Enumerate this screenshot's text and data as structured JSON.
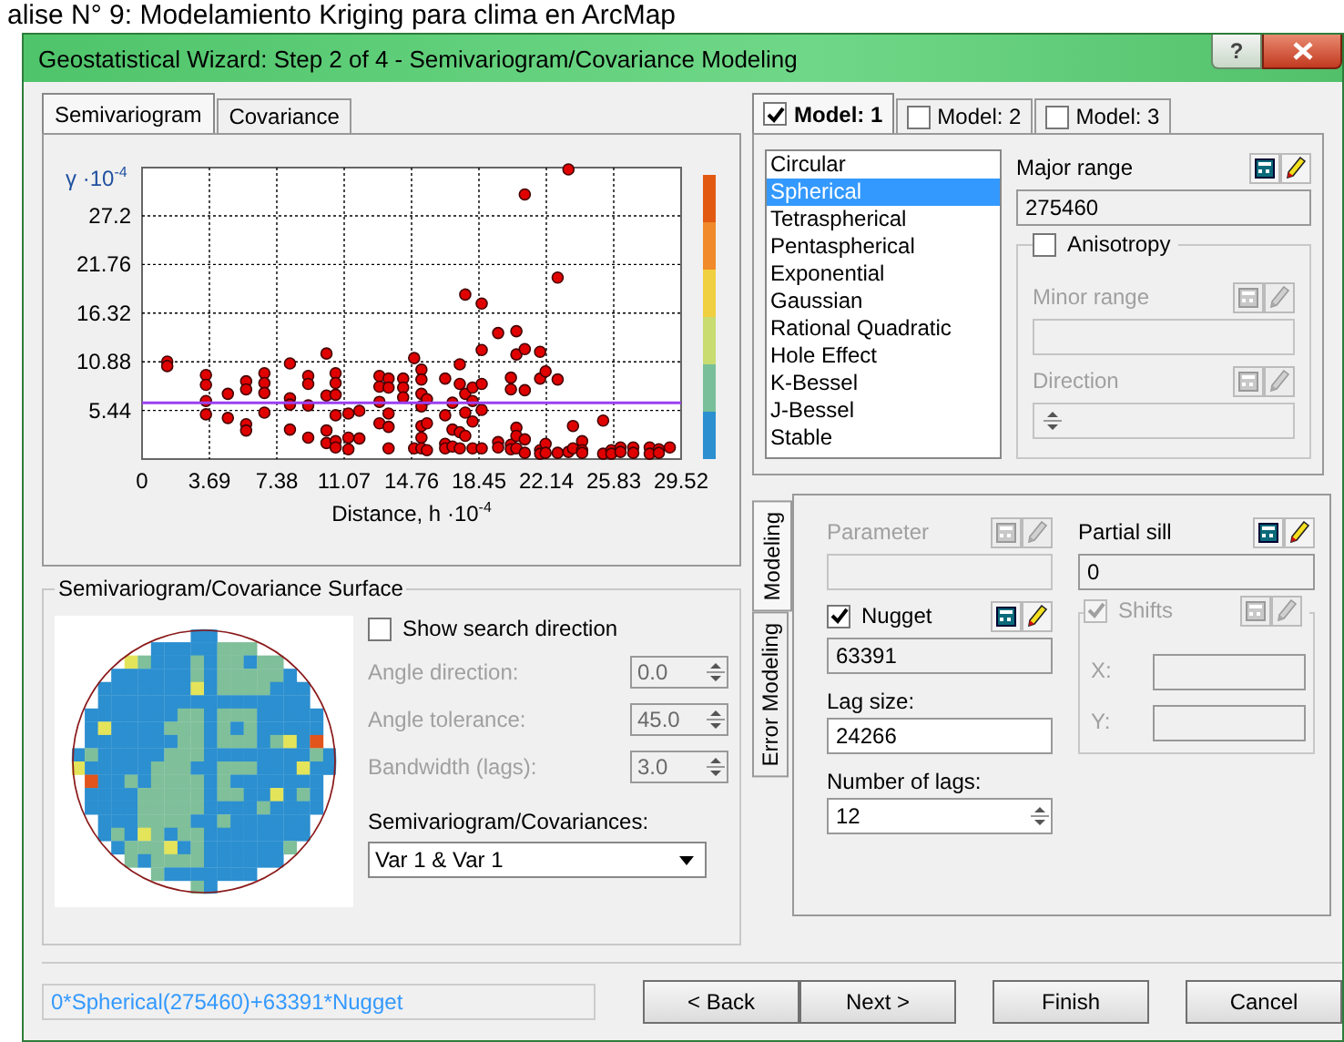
{
  "background_caption": "alise N° 9: Modelamiento Kriging para clima en ArcMap",
  "window": {
    "title": "Geostatistical Wizard: Step 2 of 4 - Semivariogram/Covariance Modeling",
    "help": "?"
  },
  "left_tabs": [
    {
      "label": "Semivariogram",
      "selected": true
    },
    {
      "label": "Covariance",
      "selected": false
    }
  ],
  "chart": {
    "chart_data": {
      "type": "scatter",
      "xlabel": "Distance, h ·10$^{-4}$",
      "ylabel": "γ ·10$^{-4}$",
      "xlim": [
        0,
        29.52
      ],
      "ylim": [
        0,
        32.6
      ],
      "xticks": [
        0,
        3.69,
        7.38,
        11.07,
        14.76,
        18.45,
        22.14,
        25.83,
        29.52
      ],
      "yticks": [
        5.44,
        10.88,
        16.32,
        21.76,
        27.2
      ],
      "x": [
        1.38,
        1.38,
        3.5,
        3.5,
        3.5,
        3.5,
        4.7,
        4.7,
        5.7,
        5.7,
        5.7,
        5.7,
        6.7,
        6.7,
        6.7,
        6.7,
        8.1,
        8.1,
        8.1,
        8.1,
        9.1,
        9.1,
        9.1,
        9.1,
        10.1,
        10.1,
        10.1,
        10.1,
        10.6,
        10.6,
        10.6,
        10.6,
        10.6,
        10.6,
        11.3,
        11.3,
        11.3,
        11.9,
        11.9,
        13.0,
        13.0,
        13.0,
        13.0,
        13.5,
        13.5,
        13.5,
        13.5,
        13.5,
        14.3,
        14.3,
        14.3,
        14.9,
        14.9,
        15.3,
        15.3,
        15.3,
        15.3,
        15.3,
        15.3,
        15.3,
        15.6,
        15.6,
        15.6,
        16.6,
        16.6,
        16.6,
        16.6,
        17.0,
        17.0,
        17.0,
        17.4,
        17.4,
        17.4,
        17.4,
        17.7,
        17.7,
        17.7,
        17.7,
        18.1,
        18.1,
        18.1,
        18.1,
        18.6,
        18.6,
        18.6,
        18.6,
        18.6,
        19.5,
        19.5,
        19.5,
        20.2,
        20.2,
        20.2,
        20.2,
        20.5,
        20.5,
        20.5,
        20.5,
        20.5,
        20.96,
        20.96,
        20.96,
        20.96,
        20.96,
        21.8,
        21.8,
        21.8,
        21.8,
        22.1,
        22.1,
        22.1,
        22.76,
        22.76,
        22.76,
        23.35,
        23.35,
        23.6,
        23.6,
        24.1,
        24.1,
        24.1,
        25.25,
        25.25,
        25.7,
        25.7,
        26.2,
        26.2,
        26.9,
        26.9,
        27.8,
        27.8,
        28.3,
        28.3,
        28.9
      ],
      "grid": true,
      "series": [
        {
          "color": "#e00000",
          "values": [
            10.9,
            10.4,
            9.4,
            8.3,
            6.5,
            5.0,
            7.3,
            4.6,
            8.7,
            7.8,
            3.9,
            3.2,
            9.6,
            8.5,
            7.4,
            5.2,
            10.7,
            6.8,
            6.1,
            3.3,
            9.3,
            8.4,
            6.0,
            2.4,
            11.8,
            7.1,
            3.2,
            1.8,
            9.6,
            8.5,
            7.2,
            4.9,
            2.0,
            1.3,
            5.1,
            2.4,
            1.1,
            5.4,
            2.3,
            9.3,
            8.1,
            6.4,
            4.0,
            9.0,
            8.0,
            5.1,
            3.6,
            1.2,
            9.0,
            8.0,
            6.9,
            11.3,
            1.2,
            10.0,
            8.9,
            7.3,
            5.9,
            3.7,
            2.4,
            1.2,
            6.7,
            4.0,
            1.0,
            9.0,
            4.9,
            1.7,
            1.2,
            6.3,
            3.3,
            1.4,
            10.6,
            8.4,
            3.0,
            1.2,
            18.4,
            7.3,
            5.2,
            2.6,
            8.0,
            6.5,
            4.2,
            1.2,
            17.4,
            12.2,
            8.4,
            5.5,
            1.2,
            14.1,
            1.9,
            1.3,
            9.1,
            7.8,
            1.6,
            1.1,
            14.3,
            11.7,
            3.5,
            2.6,
            1.2,
            29.6,
            12.3,
            7.7,
            2.2,
            0.7,
            12.0,
            9.0,
            1.0,
            0.6,
            9.8,
            1.7,
            0.7,
            20.3,
            8.9,
            0.7,
            32.4,
            0.8,
            3.7,
            1.2,
            2.0,
            1.0,
            0.7,
            4.3,
            0.6,
            1.0,
            0.6,
            1.3,
            0.8,
            1.3,
            0.7,
            1.3,
            0.6,
            1.1,
            0.7,
            1.3
          ]
        }
      ],
      "ref_lines": [
        {
          "axis": "y",
          "value": 6.3
        }
      ]
    }
  },
  "surface": {
    "title": "Semivariogram/Covariance Surface",
    "show_search_direction": {
      "label": "Show search direction",
      "checked": false
    },
    "fields": [
      {
        "label": "Angle direction:",
        "value": "0.0",
        "disabled": true
      },
      {
        "label": "Angle tolerance:",
        "value": "45.0",
        "disabled": true
      },
      {
        "label": "Bandwidth (lags):",
        "value": "3.0",
        "disabled": true
      }
    ],
    "dropdown_label": "Semivariogram/Covariances:",
    "dropdown_value": "Var 1 & Var 1"
  },
  "model_tabs": [
    {
      "label": "Model:  1",
      "checked": true,
      "selected": true
    },
    {
      "label": "Model:  2",
      "checked": false,
      "selected": false
    },
    {
      "label": "Model:  3",
      "checked": false,
      "selected": false
    }
  ],
  "model_types": [
    {
      "label": "Circular",
      "selected": false
    },
    {
      "label": "Spherical",
      "selected": true
    },
    {
      "label": "Tetraspherical",
      "selected": false
    },
    {
      "label": "Pentaspherical",
      "selected": false
    },
    {
      "label": "Exponential",
      "selected": false
    },
    {
      "label": "Gaussian",
      "selected": false
    },
    {
      "label": "Rational Quadratic",
      "selected": false
    },
    {
      "label": "Hole Effect",
      "selected": false
    },
    {
      "label": "K-Bessel",
      "selected": false
    },
    {
      "label": "J-Bessel",
      "selected": false
    },
    {
      "label": "Stable",
      "selected": false
    }
  ],
  "major_range": {
    "label": "Major range",
    "value": "275460",
    "read_only": true
  },
  "anisotropy": {
    "label": "Anisotropy",
    "checked": false
  },
  "minor_range": {
    "label": "Minor range",
    "disabled": true
  },
  "direction": {
    "label": "Direction",
    "disabled": true
  },
  "side_tabs": [
    {
      "label": "Modeling",
      "selected": true
    },
    {
      "label": "Error Modeling",
      "selected": false
    }
  ],
  "parameter": {
    "label": "Parameter",
    "disabled": true
  },
  "partial_sill": {
    "label": "Partial sill",
    "value": "0",
    "read_only": true
  },
  "nugget": {
    "label": "Nugget",
    "checked": true,
    "value": "63391",
    "read_only": true
  },
  "shifts": {
    "label": "Shifts",
    "checked": true,
    "disabled": true,
    "x_label": "X:",
    "y_label": "Y:"
  },
  "lag_size": {
    "label": "Lag size:",
    "value": "24266",
    "read_only": false
  },
  "number_of_lags": {
    "label": "Number of lags:",
    "value": "12",
    "read_only": false
  },
  "formula": "0*Spherical(275460)+63391*Nugget",
  "buttons": [
    {
      "label": "< Back"
    },
    {
      "label": "Next >"
    },
    {
      "label": "Finish"
    },
    {
      "label": "Cancel"
    }
  ]
}
